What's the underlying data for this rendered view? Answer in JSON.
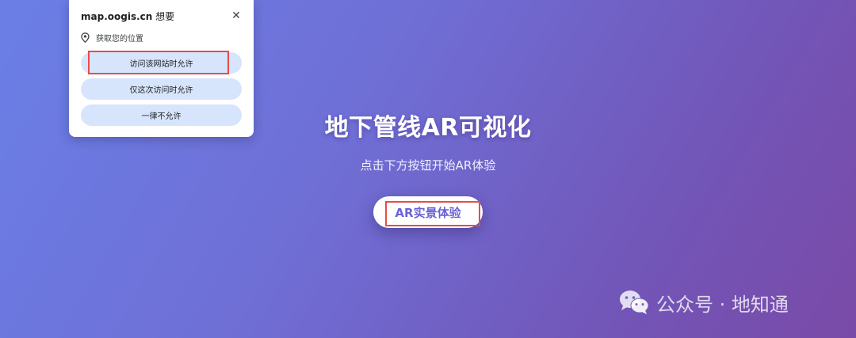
{
  "popup": {
    "site": "map.oogis.cn",
    "wants": "想要",
    "permission_label": "获取您的位置",
    "buttons": {
      "allow_while_visiting": "访问该网站时允许",
      "allow_this_time": "仅这次访问时允许",
      "never_allow": "一律不允许"
    },
    "close_glyph": "✕"
  },
  "main": {
    "title": "地下管线AR可视化",
    "subtitle": "点击下方按钮开始AR体验",
    "ar_button_label": "AR实景体验"
  },
  "watermark": {
    "text": "公众号 · 地知通"
  },
  "icons": {
    "popup_permission": "location-pin-icon",
    "popup_close": "close-icon",
    "watermark": "wechat-icon"
  },
  "colors": {
    "background_start": "#6a7fe6",
    "background_end": "#7a4aa8",
    "button_text": "#6a63d6",
    "popup_button_bg": "#d6e4fc",
    "highlight": "#e84b4b"
  }
}
